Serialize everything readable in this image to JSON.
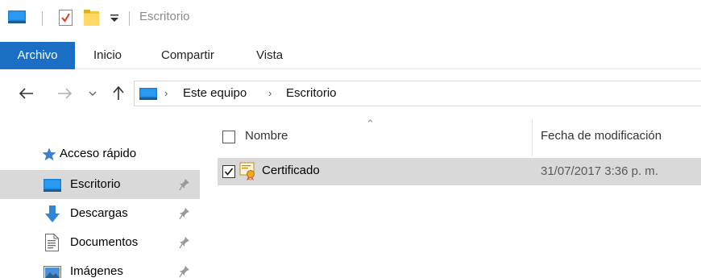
{
  "window": {
    "title": "Escritorio"
  },
  "quick_access_toolbar": {
    "icons": [
      "computer-icon",
      "properties-icon",
      "new-folder-icon",
      "customize-dropdown-icon"
    ]
  },
  "ribbon": {
    "tabs": [
      {
        "label": "Archivo",
        "active": true
      },
      {
        "label": "Inicio"
      },
      {
        "label": "Compartir"
      },
      {
        "label": "Vista"
      }
    ],
    "accent_color": "#1a6fc4"
  },
  "address_bar": {
    "breadcrumb": [
      "Este equipo",
      "Escritorio"
    ]
  },
  "navigation_pane": {
    "section": "Acceso rápido",
    "items": [
      {
        "label": "Escritorio",
        "icon": "desktop-icon",
        "pinned": true,
        "selected": true
      },
      {
        "label": "Descargas",
        "icon": "download-arrow-icon",
        "pinned": true
      },
      {
        "label": "Documentos",
        "icon": "document-icon",
        "pinned": true
      },
      {
        "label": "Imágenes",
        "icon": "pictures-icon",
        "pinned": true
      }
    ]
  },
  "file_list": {
    "columns": [
      "Nombre",
      "Fecha de modificación"
    ],
    "rows": [
      {
        "name": "Certificado",
        "modified": "31/07/2017 3:36 p. m.",
        "checked": true,
        "selected": true,
        "icon": "certificate-icon"
      }
    ]
  }
}
